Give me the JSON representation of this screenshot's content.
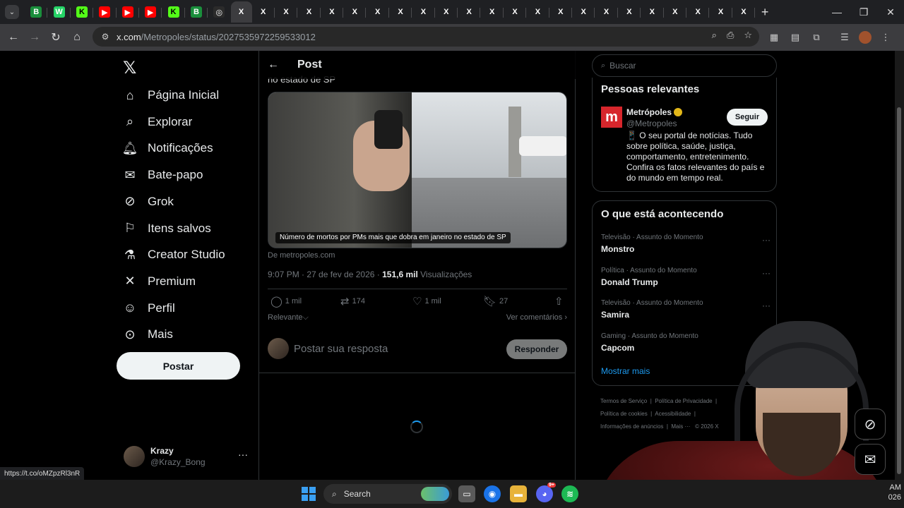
{
  "browser": {
    "tab_favicons": [
      "B",
      "W",
      "K",
      "▶",
      "▶",
      "▶",
      "K",
      "B",
      "◎",
      "X",
      "X",
      "X",
      "X",
      "X",
      "X",
      "X",
      "X",
      "X",
      "X",
      "X",
      "X",
      "X",
      "X",
      "X",
      "X",
      "X",
      "X",
      "X",
      "X",
      "X",
      "X",
      "X"
    ],
    "url_host": "x.com",
    "url_path": "/Metropoles/status/2027535972259533012",
    "status_url": "https://t.co/oMZpzRl3nR"
  },
  "nav": {
    "items": [
      {
        "label": "Página Inicial",
        "icon": "home-icon"
      },
      {
        "label": "Explorar",
        "icon": "search-icon"
      },
      {
        "label": "Notificações",
        "icon": "bell-icon"
      },
      {
        "label": "Bate-papo",
        "icon": "mail-icon"
      },
      {
        "label": "Grok",
        "icon": "grok-icon"
      },
      {
        "label": "Itens salvos",
        "icon": "bookmark-icon"
      },
      {
        "label": "Creator Studio",
        "icon": "flask-icon"
      },
      {
        "label": "Premium",
        "icon": "x-icon"
      },
      {
        "label": "Perfil",
        "icon": "person-icon"
      },
      {
        "label": "Mais",
        "icon": "more-circle-icon"
      }
    ],
    "post_button": "Postar",
    "profile": {
      "name": "Krazy",
      "handle": "@Krazy_Bong"
    }
  },
  "post": {
    "header_title": "Post",
    "cut_text": "no estado de SP",
    "media_caption": "Número de mortos por PMs mais que dobra em janeiro no estado de SP",
    "source": "De metropoles.com",
    "time": "9:07 PM · 27 de fev de 2026 · ",
    "views_count": "151,6 mil",
    "views_label": " Visualizações",
    "replies": "1 mil",
    "reposts": "174",
    "likes": "1 mil",
    "bookmarks": "27",
    "sort_label": "Relevante",
    "sort_chevron": "⌵",
    "view_comments": "Ver comentários ›",
    "reply_placeholder": "Postar sua resposta",
    "reply_button": "Responder"
  },
  "right": {
    "search_placeholder": "Buscar",
    "relevant_title": "Pessoas relevantes",
    "account": {
      "name": "Metrópoles",
      "handle": "@Metropoles",
      "follow": "Seguir",
      "bio": "📱 O seu portal de notícias. Tudo sobre política, saúde, justiça, comportamento, entretenimento. Confira os fatos relevantes do país e do mundo em tempo real."
    },
    "trending_title": "O que está acontecendo",
    "trends": [
      {
        "category": "Televisão · Assunto do Momento",
        "name": "Monstro"
      },
      {
        "category": "Política · Assunto do Momento",
        "name": "Donald Trump"
      },
      {
        "category": "Televisão · Assunto do Momento",
        "name": "Samira"
      },
      {
        "category": "Gaming · Assunto do Momento",
        "name": "Capcom"
      }
    ],
    "show_more": "Mostrar mais",
    "footer": [
      "Termos de Serviço",
      "Política de Privacidade",
      "Política de cookies",
      "Acessibilidade",
      "Informações de anúncios",
      "Mais ···",
      "© 2026 X"
    ]
  },
  "taskbar": {
    "search_label": "Search",
    "tray_time": "AM",
    "tray_date": "026",
    "discord_badge": "9+"
  }
}
